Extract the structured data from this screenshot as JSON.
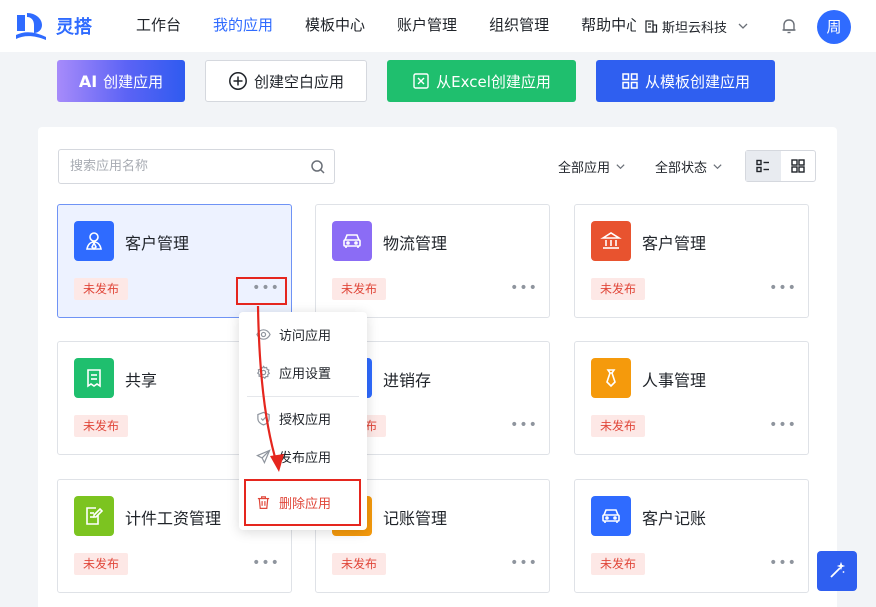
{
  "brand": {
    "name": "灵搭"
  },
  "nav": {
    "items": [
      {
        "label": "工作台"
      },
      {
        "label": "我的应用"
      },
      {
        "label": "模板中心"
      },
      {
        "label": "账户管理"
      },
      {
        "label": "组织管理"
      },
      {
        "label": "帮助中心"
      }
    ],
    "active_index": 1
  },
  "org": {
    "name": "斯坦云科技"
  },
  "user": {
    "avatar_text": "周"
  },
  "actions": {
    "ai_mark": "AI",
    "ai_label": "创建应用",
    "blank_label": "创建空白应用",
    "excel_label": "从Excel创建应用",
    "template_label": "从模板创建应用"
  },
  "search": {
    "placeholder": "搜索应用名称",
    "value": ""
  },
  "filters": {
    "scope": "全部应用",
    "status": "全部状态"
  },
  "view": {
    "mode": "list"
  },
  "apps": [
    {
      "name": "客户管理",
      "status": "未发布",
      "icon": "user-icon",
      "color": "#2f6bff",
      "selected": true
    },
    {
      "name": "物流管理",
      "status": "未发布",
      "icon": "car-icon",
      "color": "#8b6cf5"
    },
    {
      "name": "客户管理",
      "status": "未发布",
      "icon": "bank-icon",
      "color": "#e8532f"
    },
    {
      "name": "共享",
      "status": "未发布",
      "icon": "receipt-icon",
      "color": "#1fbf6e"
    },
    {
      "name": "进销存",
      "status": "未发布",
      "icon": "box-icon",
      "color": "#2f6bff"
    },
    {
      "name": "人事管理",
      "status": "未发布",
      "icon": "tie-icon",
      "color": "#f59a0c"
    },
    {
      "name": "计件工资管理",
      "status": "未发布",
      "icon": "edit-doc-icon",
      "color": "#7cc420"
    },
    {
      "name": "记账管理",
      "status": "未发布",
      "icon": "ledger-icon",
      "color": "#f59a0c"
    },
    {
      "name": "客户记账",
      "status": "未发布",
      "icon": "car-icon",
      "color": "#2f6bff"
    }
  ],
  "more_label": "•••",
  "menu": {
    "items": [
      {
        "label": "访问应用",
        "icon": "eye-icon"
      },
      {
        "label": "应用设置",
        "icon": "gear-icon"
      },
      {
        "label": "授权应用",
        "icon": "shield-icon"
      },
      {
        "label": "发布应用",
        "icon": "send-icon"
      },
      {
        "label": "删除应用",
        "icon": "trash-icon",
        "danger": true
      }
    ]
  },
  "colors": {
    "accent": "#2f6bff",
    "danger": "#e0473a",
    "annotation": "#e5261e"
  }
}
